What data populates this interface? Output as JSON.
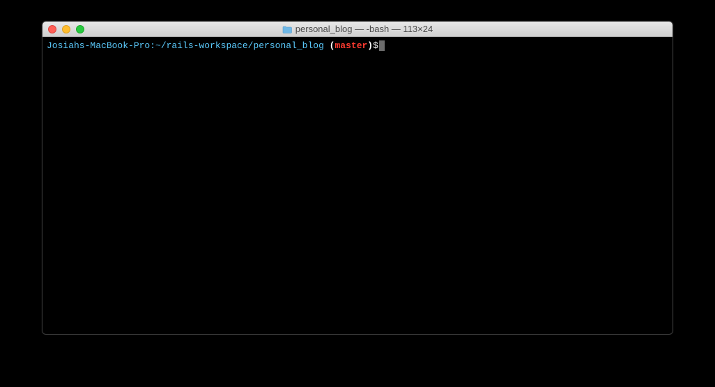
{
  "window": {
    "title": "personal_blog — -bash — 113×24"
  },
  "prompt": {
    "host": "Josiahs-MacBook-Pro:",
    "path": "~/rails-workspace/personal_blog",
    "branch_open": " (",
    "branch": "master",
    "branch_close": ")",
    "symbol": "$"
  }
}
